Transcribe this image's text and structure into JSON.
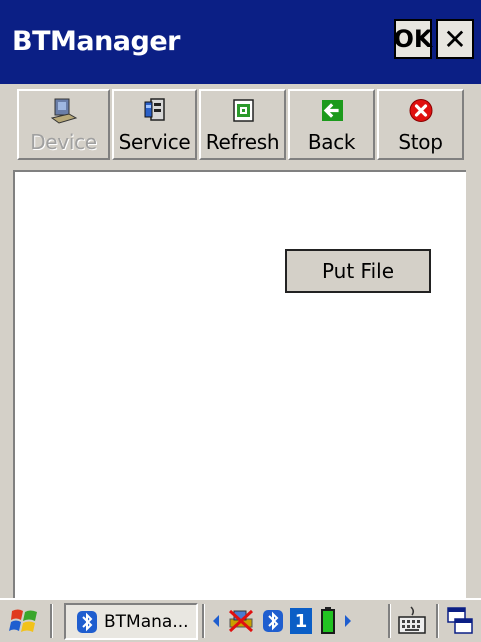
{
  "window": {
    "title": "BTManager",
    "ok_label": "OK",
    "close_label": "✕"
  },
  "toolbar": {
    "items": [
      {
        "label": "Device",
        "icon": "device-icon",
        "disabled": true
      },
      {
        "label": "Service",
        "icon": "service-icon",
        "disabled": false
      },
      {
        "label": "Refresh",
        "icon": "refresh-icon",
        "disabled": false
      },
      {
        "label": "Back",
        "icon": "back-arrow-icon",
        "disabled": false
      },
      {
        "label": "Stop",
        "icon": "stop-icon",
        "disabled": false
      }
    ]
  },
  "main": {
    "put_file_label": "Put File"
  },
  "taskbar": {
    "task_label": "BTMana...",
    "tray_number": "1"
  },
  "colors": {
    "titlebar": "#0b1f85",
    "face": "#d4d0c8",
    "content_bg": "#ffffff",
    "back_icon": "#1c9a1c",
    "stop_icon": "#e01010"
  }
}
